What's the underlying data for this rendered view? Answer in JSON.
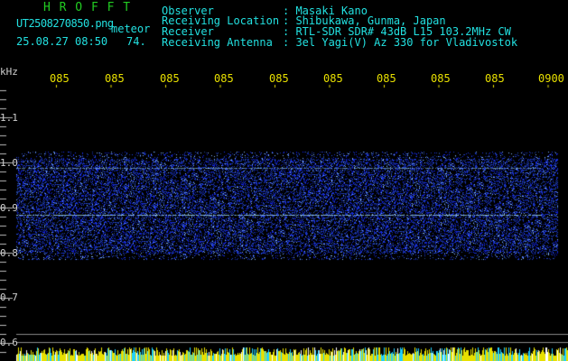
{
  "header": {
    "logo": "H R O F F T",
    "filename": "UT2508270850.png",
    "datetime": "25.08.27 08:50",
    "mode": "meteor",
    "count": "74.",
    "fields": [
      {
        "label": "Observer",
        "value": ": Masaki Kano"
      },
      {
        "label": "Receiving Location",
        "value": ": Shibukawa, Gunma, Japan"
      },
      {
        "label": "Receiver",
        "value": ": RTL-SDR SDR# 43dB L15 103.2MHz CW"
      },
      {
        "label": "Receiving Antenna",
        "value": ": 3el Yagi(V) Az 330 for Vladivostok"
      }
    ]
  },
  "axis": {
    "unit": "kHz",
    "x_ticks": [
      "085",
      "085",
      "085",
      "085",
      "085",
      "085",
      "085",
      "085",
      "085",
      "0900"
    ],
    "y_ticks": [
      "1.1",
      "1.0",
      "0.9",
      "0.8",
      "0.7",
      "0.6"
    ]
  },
  "colors": {
    "background": "#000000",
    "signal": "#2a4dff",
    "echo_line": "#9fe0ff",
    "bottom_bar": "#e8e000"
  }
}
